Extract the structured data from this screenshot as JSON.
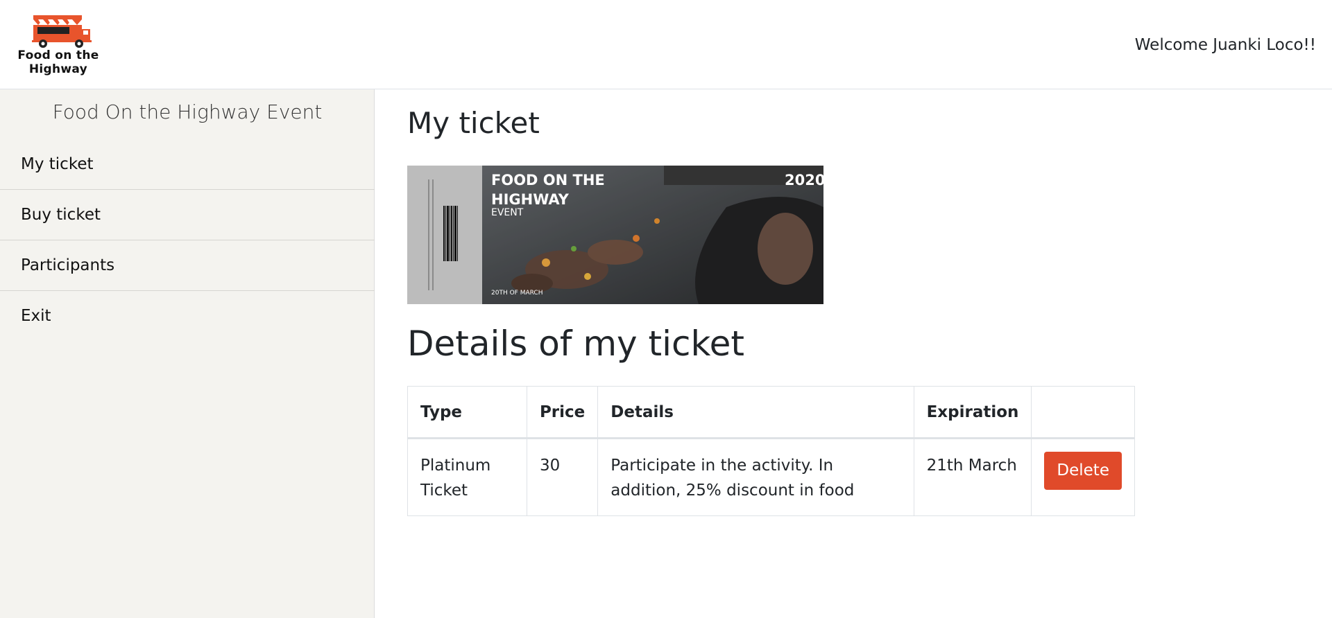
{
  "header": {
    "logo_text_line1": "Food on the",
    "logo_text_line2": "Highway",
    "welcome": "Welcome Juanki Loco!!"
  },
  "sidebar": {
    "title": "Food On the Highway Event",
    "items": [
      {
        "label": "My ticket"
      },
      {
        "label": "Buy ticket"
      },
      {
        "label": "Participants"
      },
      {
        "label": "Exit"
      }
    ]
  },
  "main": {
    "title": "My ticket",
    "ticket": {
      "title_line1": "FOOD ON THE",
      "title_line2": "HIGHWAY",
      "subtitle": "EVENT",
      "year": "2020",
      "date": "20TH OF MARCH"
    },
    "details_title": "Details of my ticket",
    "table": {
      "headers": [
        "Type",
        "Price",
        "Details",
        "Expiration",
        ""
      ],
      "rows": [
        {
          "type": "Platinum Ticket",
          "price": "30",
          "details": "Participate in the activity. In addition, 25% discount in food",
          "expiration": "21th March",
          "action": "Delete"
        }
      ]
    }
  },
  "colors": {
    "accent": "#e04a2a",
    "sidebar_bg": "#f4f3ef",
    "text": "#212529"
  }
}
